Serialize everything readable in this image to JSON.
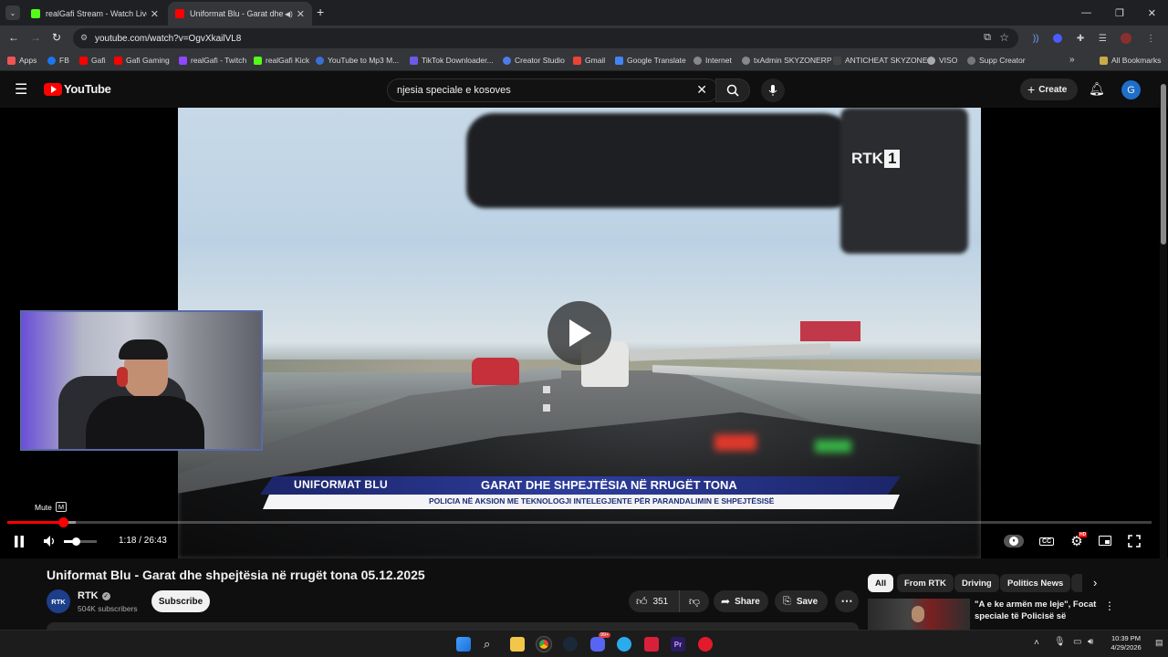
{
  "browser": {
    "tabs": [
      {
        "title": "realGafi Stream - Watch Live on",
        "active": false
      },
      {
        "title": "Uniformat Blu - Garat dhe s",
        "active": true
      }
    ],
    "new_tab": "+",
    "url": "youtube.com/watch?v=OgvXkailVL8",
    "bookmarks": [
      "Apps",
      "FB",
      "Gafi",
      "Gafi Gaming",
      "realGafi - Twitch",
      "realGafi Kick",
      "YouTube to Mp3 M...",
      "TikTok Downloader...",
      "Creator Studio",
      "Gmail",
      "Google Translate",
      "Internet",
      "txAdmin SKYZONERP",
      "ANTICHEAT SKYZONE",
      "VISO",
      "Supp Creator"
    ],
    "all_bookmarks": "All Bookmarks"
  },
  "youtube": {
    "logo": "YouTube",
    "search_value": "njesia speciale e kosoves",
    "create_label": "Create",
    "avatar_letter": "G"
  },
  "player": {
    "channel_watermark": "RTK",
    "watermark_number": "1",
    "lower_third_left": "UNIFORMAT BLU",
    "lower_third_title": "GARAT DHE SHPEJTËSIA NË RRUGËT TONA",
    "lower_third_subtitle": "POLICIA NË AKSION ME TEKNOLOGJI INTELEGJENTE PËR PARANDALIMIN E SHPEJTËSISË",
    "tooltip_label": "Mute",
    "tooltip_key": "M",
    "time": "1:18 / 26:43",
    "progress_fraction": 0.049,
    "volume_fraction": 0.35,
    "settings_badge": "HD"
  },
  "video_info": {
    "title": "Uniformat Blu - Garat dhe shpejtësia në rrugët tona 05.12.2025",
    "channel_name": "RTK",
    "channel_avatar": "RTK",
    "subscribers": "504K subscribers",
    "subscribe_label": "Subscribe",
    "likes": "351",
    "share_label": "Share",
    "save_label": "Save"
  },
  "chips": [
    "All",
    "From RTK",
    "Driving",
    "Politics News"
  ],
  "recommended": {
    "title": "\"A e ke armën me leje\", Focat speciale të Policisë së Kosovë..."
  },
  "taskbar": {
    "time": "10:39 PM",
    "date": "4/29/2026",
    "discord_badge": "99+"
  },
  "colors": {
    "accent_red": "#ff0000",
    "lower_third_blue": "#1e2c78"
  }
}
